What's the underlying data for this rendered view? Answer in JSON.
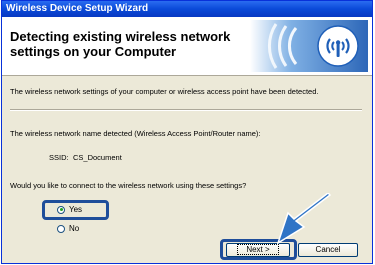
{
  "window": {
    "title": "Wireless Device Setup Wizard"
  },
  "header": {
    "title": "Detecting existing wireless network settings on your Computer",
    "logo_icon": "wireless-signal-icon"
  },
  "content": {
    "detected_message": "The wireless network settings of your computer or wireless access point have been detected.",
    "name_detected_label": "The wireless network name detected (Wireless Access Point/Router name):",
    "ssid_label": "SSID:",
    "ssid_value": "CS_Document",
    "question": "Would you like to connect to the wireless network using these settings?",
    "options": [
      {
        "label": "Yes",
        "selected": true
      },
      {
        "label": "No",
        "selected": false
      }
    ]
  },
  "buttons": {
    "next": "Next >",
    "cancel": "Cancel"
  },
  "colors": {
    "titlebar": "#0a4ad8",
    "highlight": "#1f4e9a",
    "arrow": "#2f74c6"
  }
}
